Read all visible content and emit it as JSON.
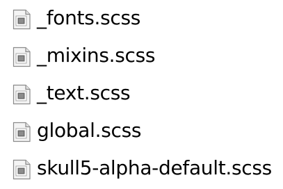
{
  "files": [
    {
      "name": "_fonts.scss",
      "icon": "document-icon"
    },
    {
      "name": "_mixins.scss",
      "icon": "document-icon"
    },
    {
      "name": "_text.scss",
      "icon": "document-icon"
    },
    {
      "name": "global.scss",
      "icon": "document-icon"
    },
    {
      "name": "skull5-alpha-default.scss",
      "icon": "document-icon"
    }
  ],
  "colors": {
    "text": "#000000",
    "icon_border": "#8a8a8a",
    "icon_fill": "#f4f4f4",
    "icon_glyph": "#6b6b6b"
  }
}
